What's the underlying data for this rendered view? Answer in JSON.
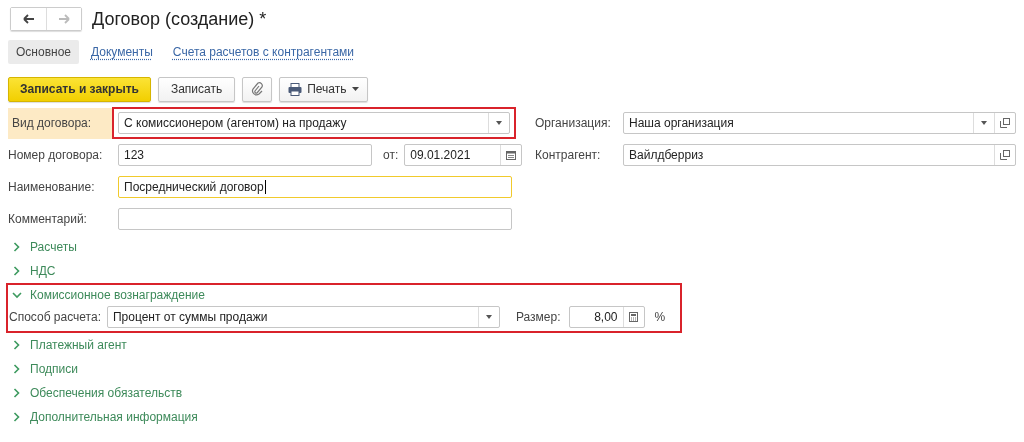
{
  "window": {
    "title": "Договор (создание) *"
  },
  "nav": {
    "back": {
      "disabled": false
    },
    "forward": {
      "disabled": true
    }
  },
  "tabs": [
    {
      "label": "Основное",
      "selected": true
    },
    {
      "label": "Документы",
      "selected": false
    },
    {
      "label": "Счета расчетов с контрагентами",
      "selected": false
    }
  ],
  "toolbar": [
    {
      "kind": "primary",
      "label": "Записать и закрыть"
    },
    {
      "kind": "plain",
      "label": "Записать"
    },
    {
      "kind": "attach"
    },
    {
      "kind": "print",
      "label": "Печать"
    }
  ],
  "contract_type": {
    "label": "Вид договора:",
    "value": "С комиссионером (агентом) на продажу",
    "highlighted": true
  },
  "number": {
    "label": "Номер договора:",
    "value": "123"
  },
  "date": {
    "label": "от:",
    "value": "09.01.2021"
  },
  "name": {
    "label": "Наименование:",
    "value": "Посреднический договор",
    "focused": true
  },
  "comment": {
    "label": "Комментарий:"
  },
  "organization": {
    "label": "Организация:",
    "value": "Наша организация"
  },
  "counterparty": {
    "label": "Контрагент:",
    "value": "Вайлдберриз"
  },
  "sections": [
    {
      "title": "Расчеты",
      "expanded": false,
      "highlighted": false
    },
    {
      "title": "НДС",
      "expanded": false,
      "highlighted": false
    },
    {
      "title": "Комиссионное вознаграждение",
      "expanded": true,
      "highlighted": true,
      "method": {
        "label": "Способ расчета:",
        "value": "Процент от суммы продажи"
      },
      "size": {
        "label": "Размер:",
        "value": "8,00",
        "unit": "%"
      }
    },
    {
      "title": "Платежный агент",
      "expanded": false,
      "highlighted": false
    },
    {
      "title": "Подписи",
      "expanded": false,
      "highlighted": false
    },
    {
      "title": "Обеспечения обязательств",
      "expanded": false,
      "highlighted": false
    },
    {
      "title": "Дополнительная информация",
      "expanded": false,
      "highlighted": false
    }
  ]
}
